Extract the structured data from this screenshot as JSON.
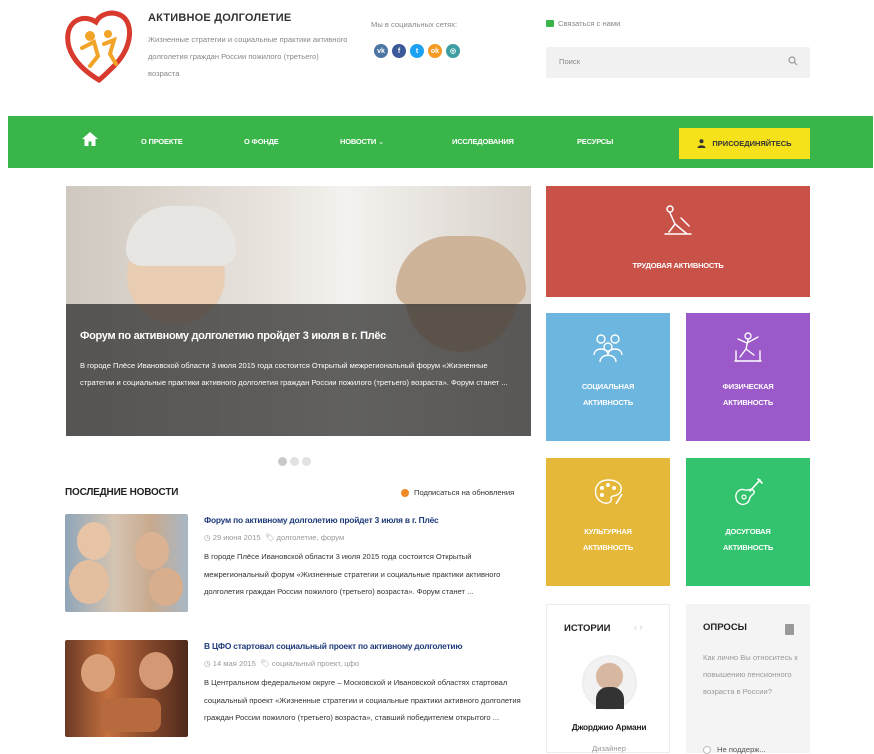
{
  "header": {
    "site_title": "АКТИВНОЕ ДОЛГОЛЕТИЕ",
    "site_description": "Жизненные стратегии и социальные практики активного долголетия граждан России пожилого (третьего) возраста",
    "social_label": "Мы в социальных сетях:",
    "social": [
      {
        "name": "vk-icon",
        "glyph": "vk",
        "color": "#4c75a3"
      },
      {
        "name": "facebook-icon",
        "glyph": "f",
        "color": "#3b5998"
      },
      {
        "name": "twitter-icon",
        "glyph": "t",
        "color": "#1da1f2"
      },
      {
        "name": "odnoklassniki-icon",
        "glyph": "ok",
        "color": "#f59a22"
      },
      {
        "name": "instagram-icon",
        "glyph": "◎",
        "color": "#3f9ea3"
      }
    ],
    "contact_label": "Связаться с нами",
    "search_placeholder": "Поиск"
  },
  "nav": {
    "items": [
      "О ПРОЕКТЕ",
      "О ФОНДЕ",
      "НОВОСТИ",
      "ИССЛЕДОВАНИЯ",
      "РЕСУРСЫ"
    ],
    "join_label": "ПРИСОЕДИНЯЙТЕСЬ",
    "accent": "#39b54a",
    "join_color": "#f5e21b"
  },
  "slider": {
    "title": "Форум по активному долголетию пройдет 3 июля в г. Плёс",
    "text": "В городе Плёсе Ивановской области 3 июля 2015 года состоится Открытый межрегиональный форум «Жизненные стратегии и социальные практики активного долголетия граждан России пожилого (третьего) возраста». Форум станет ...",
    "dots": 3
  },
  "news": {
    "heading": "ПОСЛЕДНИЕ НОВОСТИ",
    "subscribe": "Подписаться на обновления",
    "items": [
      {
        "title": "Форум по активному долголетию пройдет 3 июля в г. Плёс",
        "date": "29 июня 2015",
        "tags": "долголетие, форум",
        "text": "В городе Плёсе Ивановской области 3 июля 2015 года состоится Открытый межрегиональный форум «Жизненные стратегии и социальные практики активного долголетия граждан России пожилого (третьего) возраста». Форум станет ..."
      },
      {
        "title": "В ЦФО стартовал социальный проект по активному долголетию",
        "date": "14 мая 2015",
        "tags": "социальный проект, цфо",
        "text": "В Центральном федеральном округе – Московской и Ивановской областях стартовал социальный проект «Жизненные стратегии и социальные практики активного долголетия граждан России пожилого (третьего) возраста», ставший победителем открытого ..."
      }
    ]
  },
  "tiles": {
    "work": {
      "line1": "ТРУДОВАЯ АКТИВНОСТЬ",
      "color": "#c85148"
    },
    "social": {
      "line1": "СОЦИАЛЬНАЯ",
      "line2": "АКТИВНОСТЬ",
      "color": "#6db6df"
    },
    "physical": {
      "line1": "ФИЗИЧЕСКАЯ",
      "line2": "АКТИВНОСТЬ",
      "color": "#9b59c9"
    },
    "cultural": {
      "line1": "КУЛЬТУРНАЯ",
      "line2": "АКТИВНОСТЬ",
      "color": "#e5b83a"
    },
    "leisure": {
      "line1": "ДОСУГОВАЯ",
      "line2": "АКТИВНОСТЬ",
      "color": "#33c26e"
    }
  },
  "stories": {
    "heading": "ИСТОРИИ",
    "arrows": "‹  ›",
    "name": "Джорджио Армани",
    "role": "Дизайнер"
  },
  "polls": {
    "heading": "ОПРОСЫ",
    "question": "Как лично Вы относитесь к повышению пенсионного возраста в России?",
    "option": "Не поддерж..."
  }
}
